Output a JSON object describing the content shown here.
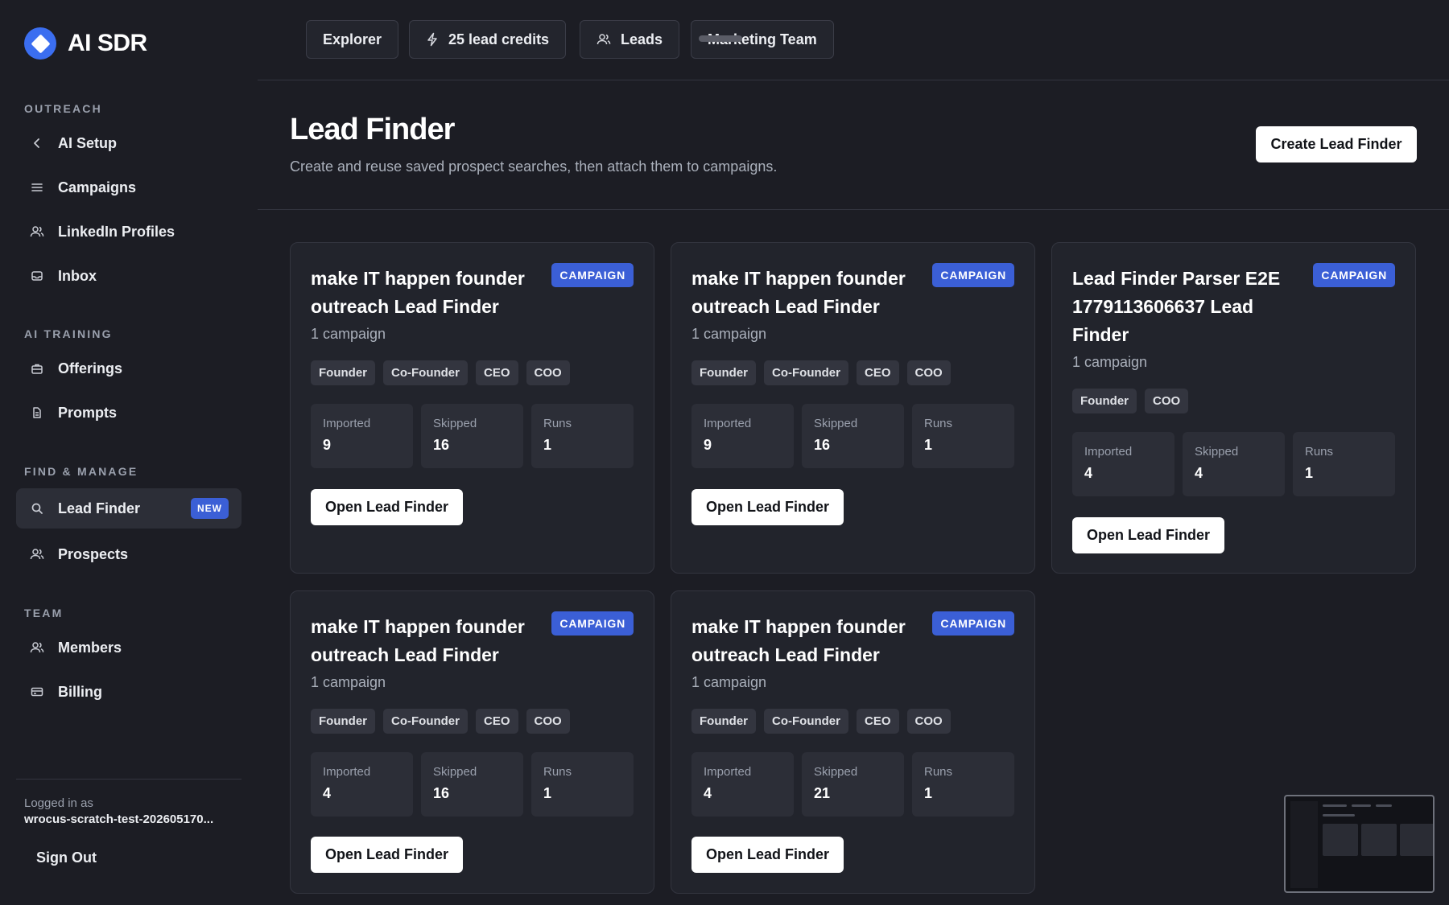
{
  "brand": {
    "name": "AI SDR"
  },
  "sidebar": {
    "sections": [
      {
        "title": "OUTREACH"
      },
      {
        "title": "AI TRAINING"
      },
      {
        "title": "FIND & MANAGE"
      },
      {
        "title": "TEAM"
      }
    ],
    "items": [
      {
        "label": "AI Setup",
        "icon": "chevron-left-icon"
      },
      {
        "label": "Campaigns",
        "icon": "menu-lines-icon"
      },
      {
        "label": "LinkedIn Profiles",
        "icon": "users-icon"
      },
      {
        "label": "Inbox",
        "icon": "inbox-icon"
      },
      {
        "label": "Offerings",
        "icon": "briefcase-icon"
      },
      {
        "label": "Prompts",
        "icon": "document-icon"
      },
      {
        "label": "Lead Finder",
        "icon": "search-icon",
        "badge": "NEW",
        "active": true
      },
      {
        "label": "Prospects",
        "icon": "users-icon"
      },
      {
        "label": "Members",
        "icon": "users-icon"
      },
      {
        "label": "Billing",
        "icon": "credit-card-icon"
      }
    ],
    "logged_label": "Logged in as",
    "logged_user": "wrocus-scratch-test-202605170...",
    "sign_out": "Sign Out"
  },
  "topbar": {
    "explorer": "Explorer",
    "credits": "25 lead credits",
    "leads": "Leads",
    "team": "Marketing Team"
  },
  "header": {
    "title": "Lead Finder",
    "subtitle": "Create and reuse saved prospect searches, then attach them to campaigns.",
    "create_button": "Create Lead Finder"
  },
  "labels": {
    "imported": "Imported",
    "skipped": "Skipped",
    "runs": "Runs",
    "open_button": "Open Lead Finder"
  },
  "cards": [
    {
      "title": "make IT happen founder outreach Lead Finder",
      "badge": "CAMPAIGN",
      "subtitle": "1 campaign",
      "tags": [
        "Founder",
        "Co-Founder",
        "CEO",
        "COO"
      ],
      "imported": "9",
      "skipped": "16",
      "runs": "1"
    },
    {
      "title": "make IT happen founder outreach Lead Finder",
      "badge": "CAMPAIGN",
      "subtitle": "1 campaign",
      "tags": [
        "Founder",
        "Co-Founder",
        "CEO",
        "COO"
      ],
      "imported": "9",
      "skipped": "16",
      "runs": "1"
    },
    {
      "title": "Lead Finder Parser E2E 1779113606637 Lead Finder",
      "badge": "CAMPAIGN",
      "subtitle": "1 campaign",
      "tags": [
        "Founder",
        "COO"
      ],
      "imported": "4",
      "skipped": "4",
      "runs": "1"
    },
    {
      "title": "make IT happen founder outreach Lead Finder",
      "badge": "CAMPAIGN",
      "subtitle": "1 campaign",
      "tags": [
        "Founder",
        "Co-Founder",
        "CEO",
        "COO"
      ],
      "imported": "4",
      "skipped": "16",
      "runs": "1"
    },
    {
      "title": "make IT happen founder outreach Lead Finder",
      "badge": "CAMPAIGN",
      "subtitle": "1 campaign",
      "tags": [
        "Founder",
        "Co-Founder",
        "CEO",
        "COO"
      ],
      "imported": "4",
      "skipped": "21",
      "runs": "1"
    }
  ]
}
